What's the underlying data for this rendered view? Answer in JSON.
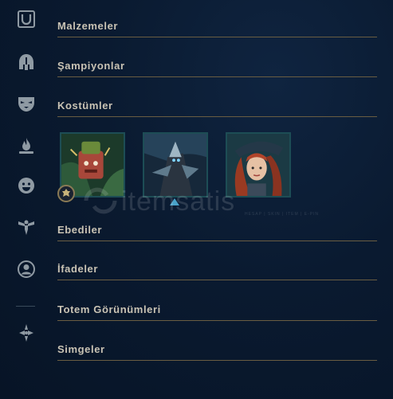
{
  "sidebar": {
    "icons": [
      {
        "name": "emblem-icon"
      },
      {
        "name": "helmet-icon"
      },
      {
        "name": "mask-icon"
      },
      {
        "name": "flame-icon"
      },
      {
        "name": "emote-face-icon"
      },
      {
        "name": "ward-icon"
      },
      {
        "name": "profile-icon"
      },
      {
        "name": "totem-icon"
      }
    ]
  },
  "sections": {
    "malzemeler": "Malzemeler",
    "sampiyonlar": "Şampiyonlar",
    "kostumler": "Kostümler",
    "ebediler": "Ebediler",
    "ifadeler": "İfadeler",
    "totem": "Totem Görünümleri",
    "simgeler": "Simgeler"
  },
  "skins": [
    {
      "name": "skin-tile-1",
      "badge": "rank-badge-icon"
    },
    {
      "name": "skin-tile-2",
      "badge": "blue-triangle-icon"
    },
    {
      "name": "skin-tile-3"
    }
  ],
  "watermark": {
    "text": "itemsatis",
    "sub": "HESAP | SKIN | ITEM | E-PIN"
  },
  "colors": {
    "background": "#0a1a30",
    "title_text": "#c9c3b4",
    "divider_gold": "#6a5d42",
    "tile_border": "#1d4d55",
    "icon_gray": "#8f9aa3"
  }
}
